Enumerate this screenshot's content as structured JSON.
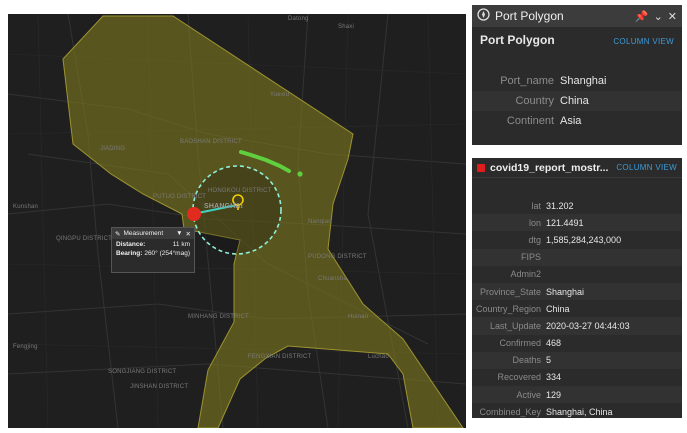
{
  "map": {
    "labels": [
      {
        "id": "label-datong",
        "text": "Datong"
      },
      {
        "id": "label-shaxi",
        "text": "Shaxi"
      },
      {
        "id": "label-yuexiu",
        "text": "Yuexiu"
      },
      {
        "id": "label-baoshan",
        "text": "BAOSHAN DISTRICT"
      },
      {
        "id": "label-jiading",
        "text": "JIADING"
      },
      {
        "id": "label-shanghai",
        "text": "SHANGHAI"
      },
      {
        "id": "label-putuo",
        "text": "PUTUO DISTRICT"
      },
      {
        "id": "label-hongkou",
        "text": "HONGKOU DISTRICT"
      },
      {
        "id": "label-qingpu",
        "text": "QINGPU DISTRICT"
      },
      {
        "id": "label-songjiang",
        "text": "SONGJIANG DISTRICT"
      },
      {
        "id": "label-minhang",
        "text": "MINHANG DISTRICT"
      },
      {
        "id": "label-fengxian",
        "text": "FENGXIAN DISTRICT"
      },
      {
        "id": "label-pudong",
        "text": "PUDONG DISTRICT"
      },
      {
        "id": "label-jinshan",
        "text": "JINSHAN DISTRICT"
      },
      {
        "id": "label-kunshan",
        "text": "Kunshan"
      },
      {
        "id": "label-fengjing",
        "text": "Fengjing"
      },
      {
        "id": "label-nanqiao",
        "text": "Nanqiao"
      },
      {
        "id": "label-huinan",
        "text": "Huinan"
      },
      {
        "id": "label-luchao",
        "text": "Luchao"
      },
      {
        "id": "label-chuansha",
        "text": "Chuansha"
      }
    ],
    "colors": {
      "polygon": "#807a1e",
      "route": "#5fcf3e",
      "measure_line": "#3fd0c0",
      "marker": "#e12b1f"
    }
  },
  "measurement": {
    "title": "Measurement",
    "distance_label": "Distance:",
    "distance_value": "11 km",
    "bearing_label": "Bearing:",
    "bearing_value": "260° (254°mag)"
  },
  "port_panel": {
    "window_title": "Port Polygon",
    "title": "Port Polygon",
    "view_toggle": "COLUMN VIEW",
    "rows": [
      {
        "k": "Port_name",
        "v": "Shanghai"
      },
      {
        "k": "Country",
        "v": "China"
      },
      {
        "k": "Continent",
        "v": "Asia"
      }
    ]
  },
  "covid_panel": {
    "title": "covid19_report_mostr...",
    "view_toggle": "COLUMN VIEW",
    "rows": [
      {
        "k": "lat",
        "v": "31.202"
      },
      {
        "k": "lon",
        "v": "121.4491"
      },
      {
        "k": "dtg",
        "v": "1,585,284,243,000"
      },
      {
        "k": "FIPS",
        "v": ""
      },
      {
        "k": "Admin2",
        "v": ""
      },
      {
        "k": "Province_State",
        "v": "Shanghai"
      },
      {
        "k": "Country_Region",
        "v": "China"
      },
      {
        "k": "Last_Update",
        "v": "2020-03-27 04:44:03"
      },
      {
        "k": "Confirmed",
        "v": "468"
      },
      {
        "k": "Deaths",
        "v": "5"
      },
      {
        "k": "Recovered",
        "v": "334"
      },
      {
        "k": "Active",
        "v": "129"
      },
      {
        "k": "Combined_Key",
        "v": "Shanghai, China"
      }
    ]
  }
}
